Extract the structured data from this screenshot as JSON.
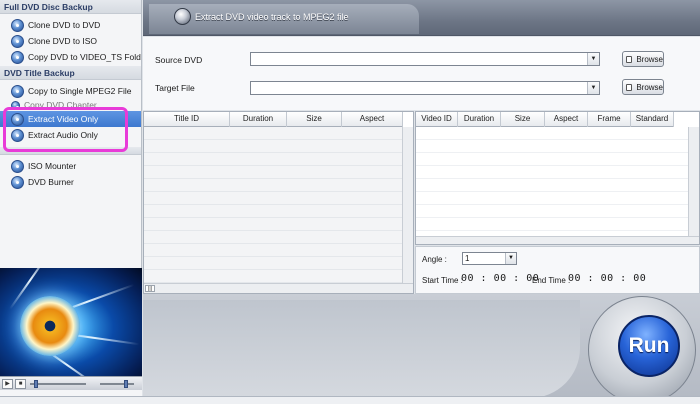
{
  "sidebar": {
    "sections": [
      {
        "title": "Full DVD Disc Backup",
        "items": [
          {
            "label": "Clone DVD to DVD"
          },
          {
            "label": "Clone DVD to ISO"
          },
          {
            "label": "Copy DVD to VIDEO_TS Folder"
          }
        ]
      },
      {
        "title": "DVD Title Backup",
        "items": [
          {
            "label": "Copy to Single MPEG2 File"
          },
          {
            "label": "Copy DVD Chapter"
          },
          {
            "label": "Extract Video Only",
            "selected": true
          },
          {
            "label": "Extract Audio Only"
          }
        ]
      },
      {
        "title": "",
        "items": [
          {
            "label": "ISO Mounter"
          },
          {
            "label": "DVD Burner"
          }
        ]
      }
    ],
    "highlight_color": "#e83bd8",
    "player": {
      "buttons": [
        "play-icon",
        "stop-icon"
      ],
      "progress": 0.1,
      "volume": 0.75
    }
  },
  "header": {
    "title": "Extract DVD video track to MPEG2 file"
  },
  "form": {
    "source_label": "Source DVD",
    "source_value": "",
    "target_label": "Target File",
    "target_value": "",
    "browse_label": "Browse"
  },
  "title_table": {
    "columns": [
      "",
      "Title ID",
      "Duration",
      "Size",
      "Aspect"
    ],
    "rows": []
  },
  "video_table": {
    "columns": [
      "Video ID",
      "Duration",
      "Size",
      "Aspect",
      "Frame",
      "Standard"
    ],
    "rows": []
  },
  "options": {
    "angle_label": "Angle :",
    "angle_value": "1",
    "start_label": "Start Time :",
    "start_value": "00 : 00 : 00",
    "end_label": "End Time :",
    "end_value": "00 : 00 : 00"
  },
  "run_label": "Run",
  "colors": {
    "accent": "#3c7ad1",
    "run_button": "#2864d8"
  }
}
